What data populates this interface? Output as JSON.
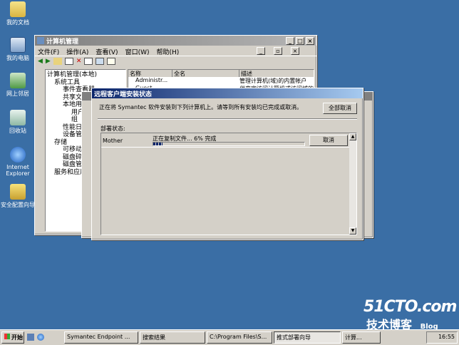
{
  "desktop": {
    "icons": [
      {
        "label": "我的文档",
        "icon": "documents-icon"
      },
      {
        "label": "我的电脑",
        "icon": "computer-icon"
      },
      {
        "label": "网上邻居",
        "icon": "network-icon"
      },
      {
        "label": "回收站",
        "icon": "recycle-bin-icon"
      },
      {
        "label": "Internet Explorer",
        "icon": "ie-icon"
      },
      {
        "label": "安全配置向导",
        "icon": "wizard-icon"
      }
    ],
    "watermark": {
      "site": "51CTO.com",
      "sub": "技术博客",
      "blog": "Blog"
    }
  },
  "mmc": {
    "title": "计算机管理",
    "menu": [
      "文件(F)",
      "操作(A)",
      "查看(V)",
      "窗口(W)",
      "帮助(H)"
    ],
    "tree": [
      "计算机管理(本地)",
      "系统工具",
      "事件查看器",
      "共享文件",
      "本地用户",
      "用户",
      "组",
      "性能日",
      "设备管",
      "存储",
      "可移动",
      "磁盘碎",
      "磁盘管",
      "服务和应用"
    ],
    "columns": [
      "名称",
      "全名",
      "描述"
    ],
    "rows": [
      {
        "name": "Administr...",
        "full": "",
        "desc": "管理计算机(域)的内置帐户"
      },
      {
        "name": "Guest",
        "full": "",
        "desc": "供来宾访问计算机或访问域的内"
      }
    ]
  },
  "dialog": {
    "title": "远程客户端安装状态",
    "message": "正在将 Symantec 软件安装到下列计算机上。请等到所有安装均已完成或取消。",
    "cancel_all": "全部取消",
    "deploy_label": "部署状态:",
    "row": {
      "computer": "Mother",
      "status": "正在复制文件... 6% 完成",
      "cancel": "取消",
      "progress": 0.06
    }
  },
  "taskbar": {
    "start": "开始",
    "tasks": [
      "Symantec Endpoint ...",
      "搜索结果",
      "C:\\Program Files\\S...",
      "推式部署向导",
      "计算..."
    ],
    "clock": "16:55"
  }
}
